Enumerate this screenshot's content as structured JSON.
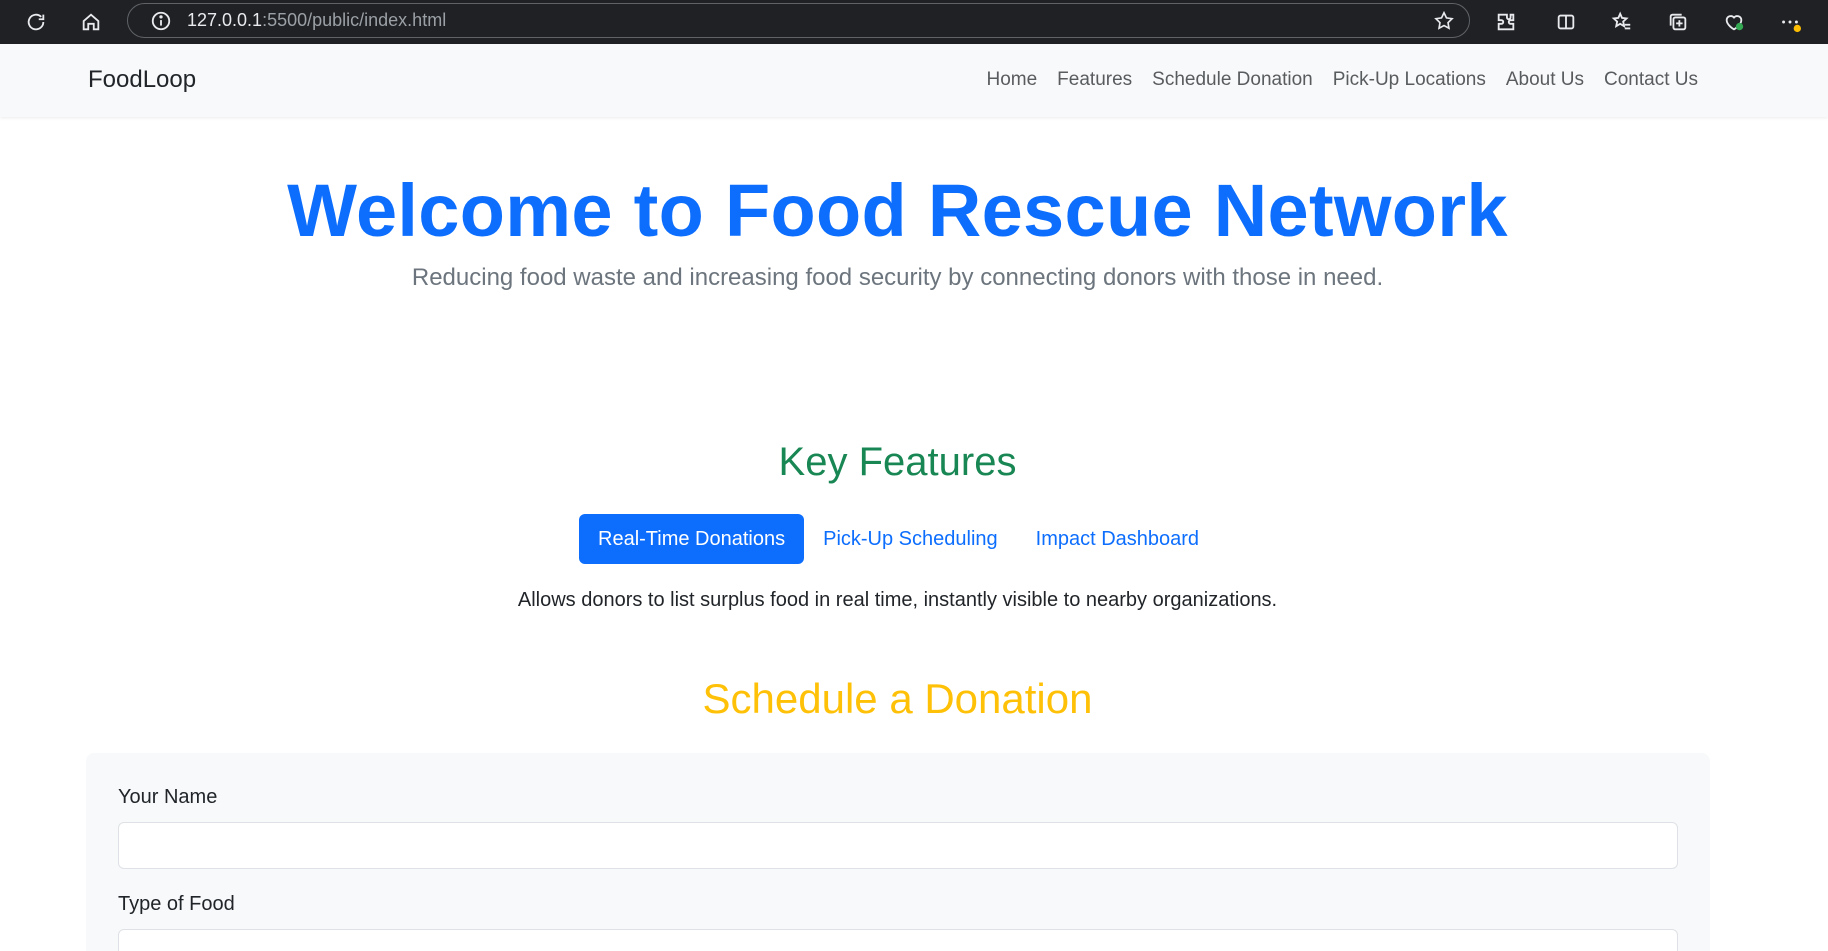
{
  "browser": {
    "url_host": "127.0.0.1",
    "url_path": ":5500/public/index.html"
  },
  "navbar": {
    "brand": "FoodLoop",
    "links": [
      "Home",
      "Features",
      "Schedule Donation",
      "Pick-Up Locations",
      "About Us",
      "Contact Us"
    ]
  },
  "hero": {
    "title": "Welcome to Food Rescue Network",
    "subtitle": "Reducing food waste and increasing food security by connecting donors with those in need."
  },
  "features": {
    "title": "Key Features",
    "tabs": [
      "Real-Time Donations",
      "Pick-Up Scheduling",
      "Impact Dashboard"
    ],
    "active_tab": "Real-Time Donations",
    "description": "Allows donors to list surplus food in real time, instantly visible to nearby organizations."
  },
  "donation": {
    "title": "Schedule a Donation",
    "name_label": "Your Name",
    "name_value": "",
    "food_label": "Type of Food",
    "food_value": ""
  },
  "colors": {
    "primary": "#0d6efd",
    "success": "#198754",
    "warning": "#ffc107"
  }
}
